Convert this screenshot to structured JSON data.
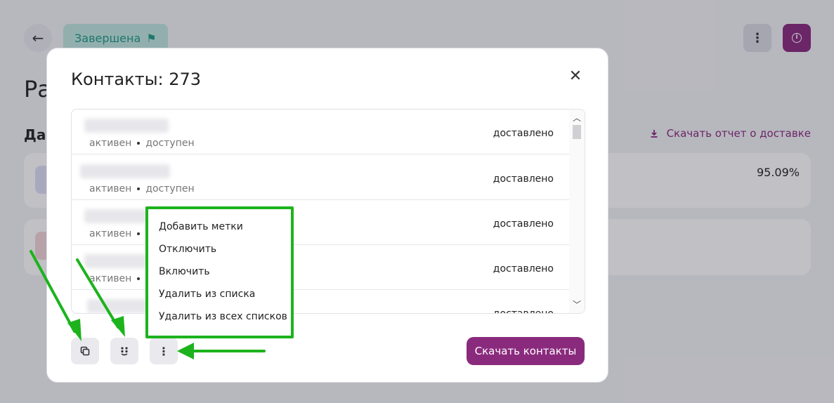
{
  "background": {
    "status_badge": "Завершена",
    "title_partial": "Ра",
    "subtitle_partial": "Дан",
    "download_report_link": "Скачать отчет о доставке",
    "percent_value": "95.09%"
  },
  "modal": {
    "title": "Контакты: 273",
    "contacts": [
      {
        "meta_left": "активен",
        "meta_right": "доступен",
        "status": "доставлено"
      },
      {
        "meta_left": "активен",
        "meta_right": "доступен",
        "status": "доставлено"
      },
      {
        "meta_left": "активен",
        "meta_right": "",
        "status": "доставлено"
      },
      {
        "meta_left": "активен",
        "meta_right": "",
        "status": "доставлено"
      },
      {
        "meta_left": "",
        "meta_right": "",
        "status": "доставлено"
      }
    ],
    "download_contacts_button": "Скачать контакты"
  },
  "menu": {
    "items": [
      "Добавить метки",
      "Отключить",
      "Включить",
      "Удалить из списка",
      "Удалить из всех списков"
    ]
  },
  "colors": {
    "accent": "#8a2a7d",
    "annotation_green": "#1db31d",
    "status_badge_text": "#1f9a86"
  }
}
